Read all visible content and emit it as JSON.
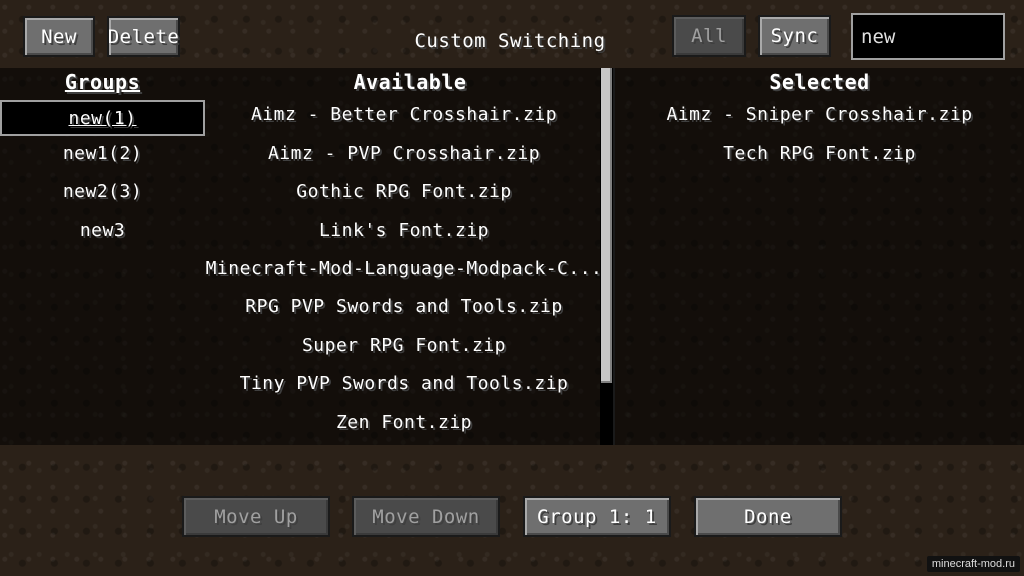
{
  "toolbar": {
    "new_label": "New",
    "delete_label": "Delete",
    "all_label": "All",
    "sync_label": "Sync",
    "search_value": "new"
  },
  "title": "Custom Switching",
  "columns": {
    "groups": "Groups",
    "available": "Available",
    "selected": "Selected"
  },
  "groups": [
    {
      "label": "new(1)",
      "active": true
    },
    {
      "label": "new1(2)",
      "active": false
    },
    {
      "label": "new2(3)",
      "active": false
    },
    {
      "label": "new3",
      "active": false
    }
  ],
  "available": [
    "Aimz - Better Crosshair.zip",
    "Aimz - PVP Crosshair.zip",
    "Gothic RPG Font.zip",
    "Link's Font.zip",
    "Minecraft-Mod-Language-Modpack-C...",
    "RPG PVP Swords and Tools.zip",
    "Super RPG Font.zip",
    "Tiny PVP Swords and Tools.zip",
    "Zen Font.zip"
  ],
  "selected": [
    "Aimz - Sniper Crosshair.zip",
    "Tech RPG Font.zip"
  ],
  "bottom": {
    "move_up_label": "Move Up",
    "move_down_label": "Move Down",
    "group_label": "Group 1: 1",
    "done_label": "Done"
  },
  "watermark": "minecraft-mod.ru"
}
